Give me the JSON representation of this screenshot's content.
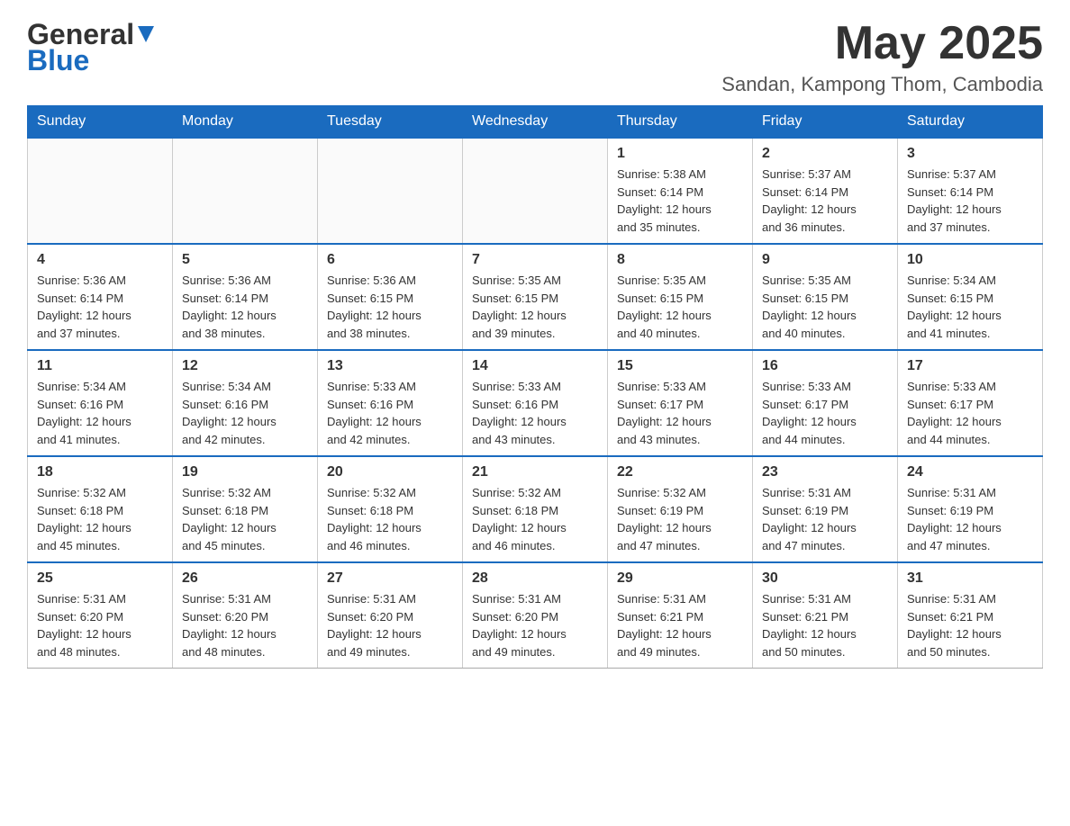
{
  "header": {
    "logo_general": "General",
    "logo_blue": "Blue",
    "month_year": "May 2025",
    "location": "Sandan, Kampong Thom, Cambodia"
  },
  "days_of_week": [
    "Sunday",
    "Monday",
    "Tuesday",
    "Wednesday",
    "Thursday",
    "Friday",
    "Saturday"
  ],
  "weeks": [
    {
      "days": [
        {
          "num": "",
          "info": ""
        },
        {
          "num": "",
          "info": ""
        },
        {
          "num": "",
          "info": ""
        },
        {
          "num": "",
          "info": ""
        },
        {
          "num": "1",
          "info": "Sunrise: 5:38 AM\nSunset: 6:14 PM\nDaylight: 12 hours\nand 35 minutes."
        },
        {
          "num": "2",
          "info": "Sunrise: 5:37 AM\nSunset: 6:14 PM\nDaylight: 12 hours\nand 36 minutes."
        },
        {
          "num": "3",
          "info": "Sunrise: 5:37 AM\nSunset: 6:14 PM\nDaylight: 12 hours\nand 37 minutes."
        }
      ]
    },
    {
      "days": [
        {
          "num": "4",
          "info": "Sunrise: 5:36 AM\nSunset: 6:14 PM\nDaylight: 12 hours\nand 37 minutes."
        },
        {
          "num": "5",
          "info": "Sunrise: 5:36 AM\nSunset: 6:14 PM\nDaylight: 12 hours\nand 38 minutes."
        },
        {
          "num": "6",
          "info": "Sunrise: 5:36 AM\nSunset: 6:15 PM\nDaylight: 12 hours\nand 38 minutes."
        },
        {
          "num": "7",
          "info": "Sunrise: 5:35 AM\nSunset: 6:15 PM\nDaylight: 12 hours\nand 39 minutes."
        },
        {
          "num": "8",
          "info": "Sunrise: 5:35 AM\nSunset: 6:15 PM\nDaylight: 12 hours\nand 40 minutes."
        },
        {
          "num": "9",
          "info": "Sunrise: 5:35 AM\nSunset: 6:15 PM\nDaylight: 12 hours\nand 40 minutes."
        },
        {
          "num": "10",
          "info": "Sunrise: 5:34 AM\nSunset: 6:15 PM\nDaylight: 12 hours\nand 41 minutes."
        }
      ]
    },
    {
      "days": [
        {
          "num": "11",
          "info": "Sunrise: 5:34 AM\nSunset: 6:16 PM\nDaylight: 12 hours\nand 41 minutes."
        },
        {
          "num": "12",
          "info": "Sunrise: 5:34 AM\nSunset: 6:16 PM\nDaylight: 12 hours\nand 42 minutes."
        },
        {
          "num": "13",
          "info": "Sunrise: 5:33 AM\nSunset: 6:16 PM\nDaylight: 12 hours\nand 42 minutes."
        },
        {
          "num": "14",
          "info": "Sunrise: 5:33 AM\nSunset: 6:16 PM\nDaylight: 12 hours\nand 43 minutes."
        },
        {
          "num": "15",
          "info": "Sunrise: 5:33 AM\nSunset: 6:17 PM\nDaylight: 12 hours\nand 43 minutes."
        },
        {
          "num": "16",
          "info": "Sunrise: 5:33 AM\nSunset: 6:17 PM\nDaylight: 12 hours\nand 44 minutes."
        },
        {
          "num": "17",
          "info": "Sunrise: 5:33 AM\nSunset: 6:17 PM\nDaylight: 12 hours\nand 44 minutes."
        }
      ]
    },
    {
      "days": [
        {
          "num": "18",
          "info": "Sunrise: 5:32 AM\nSunset: 6:18 PM\nDaylight: 12 hours\nand 45 minutes."
        },
        {
          "num": "19",
          "info": "Sunrise: 5:32 AM\nSunset: 6:18 PM\nDaylight: 12 hours\nand 45 minutes."
        },
        {
          "num": "20",
          "info": "Sunrise: 5:32 AM\nSunset: 6:18 PM\nDaylight: 12 hours\nand 46 minutes."
        },
        {
          "num": "21",
          "info": "Sunrise: 5:32 AM\nSunset: 6:18 PM\nDaylight: 12 hours\nand 46 minutes."
        },
        {
          "num": "22",
          "info": "Sunrise: 5:32 AM\nSunset: 6:19 PM\nDaylight: 12 hours\nand 47 minutes."
        },
        {
          "num": "23",
          "info": "Sunrise: 5:31 AM\nSunset: 6:19 PM\nDaylight: 12 hours\nand 47 minutes."
        },
        {
          "num": "24",
          "info": "Sunrise: 5:31 AM\nSunset: 6:19 PM\nDaylight: 12 hours\nand 47 minutes."
        }
      ]
    },
    {
      "days": [
        {
          "num": "25",
          "info": "Sunrise: 5:31 AM\nSunset: 6:20 PM\nDaylight: 12 hours\nand 48 minutes."
        },
        {
          "num": "26",
          "info": "Sunrise: 5:31 AM\nSunset: 6:20 PM\nDaylight: 12 hours\nand 48 minutes."
        },
        {
          "num": "27",
          "info": "Sunrise: 5:31 AM\nSunset: 6:20 PM\nDaylight: 12 hours\nand 49 minutes."
        },
        {
          "num": "28",
          "info": "Sunrise: 5:31 AM\nSunset: 6:20 PM\nDaylight: 12 hours\nand 49 minutes."
        },
        {
          "num": "29",
          "info": "Sunrise: 5:31 AM\nSunset: 6:21 PM\nDaylight: 12 hours\nand 49 minutes."
        },
        {
          "num": "30",
          "info": "Sunrise: 5:31 AM\nSunset: 6:21 PM\nDaylight: 12 hours\nand 50 minutes."
        },
        {
          "num": "31",
          "info": "Sunrise: 5:31 AM\nSunset: 6:21 PM\nDaylight: 12 hours\nand 50 minutes."
        }
      ]
    }
  ]
}
